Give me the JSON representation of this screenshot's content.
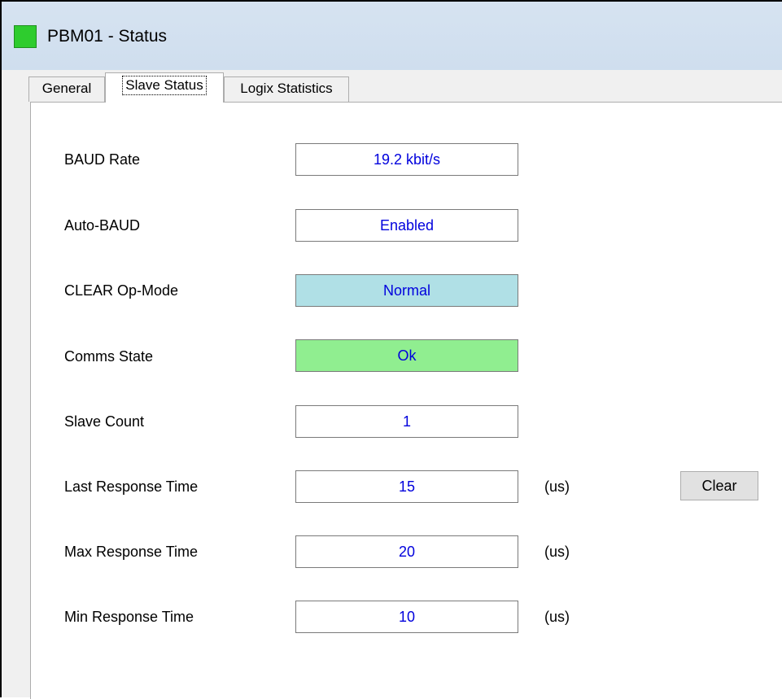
{
  "window": {
    "title": "PBM01 - Status",
    "status_color": "#2ecc2e"
  },
  "tabs": [
    {
      "label": "General",
      "active": false
    },
    {
      "label": "Slave Status",
      "active": true
    },
    {
      "label": "Logix Statistics",
      "active": false
    }
  ],
  "fields": {
    "baud_rate": {
      "label": "BAUD Rate",
      "value": "19.2 kbit/s"
    },
    "auto_baud": {
      "label": "Auto-BAUD",
      "value": "Enabled"
    },
    "clear_op_mode": {
      "label": "CLEAR Op-Mode",
      "value": "Normal",
      "bg_color": "#b0e0e6"
    },
    "comms_state": {
      "label": "Comms State",
      "value": "Ok",
      "bg_color": "#90ee90"
    },
    "slave_count": {
      "label": "Slave Count",
      "value": "1"
    },
    "last_response_time": {
      "label": "Last Response Time",
      "value": "15",
      "unit": "(us)"
    },
    "max_response_time": {
      "label": "Max Response Time",
      "value": "20",
      "unit": "(us)"
    },
    "min_response_time": {
      "label": "Min Response Time",
      "value": "10",
      "unit": "(us)"
    }
  },
  "buttons": {
    "clear_label": "Clear"
  },
  "colors": {
    "value_text": "#0000dd",
    "titlebar": "#d3e1f0"
  }
}
